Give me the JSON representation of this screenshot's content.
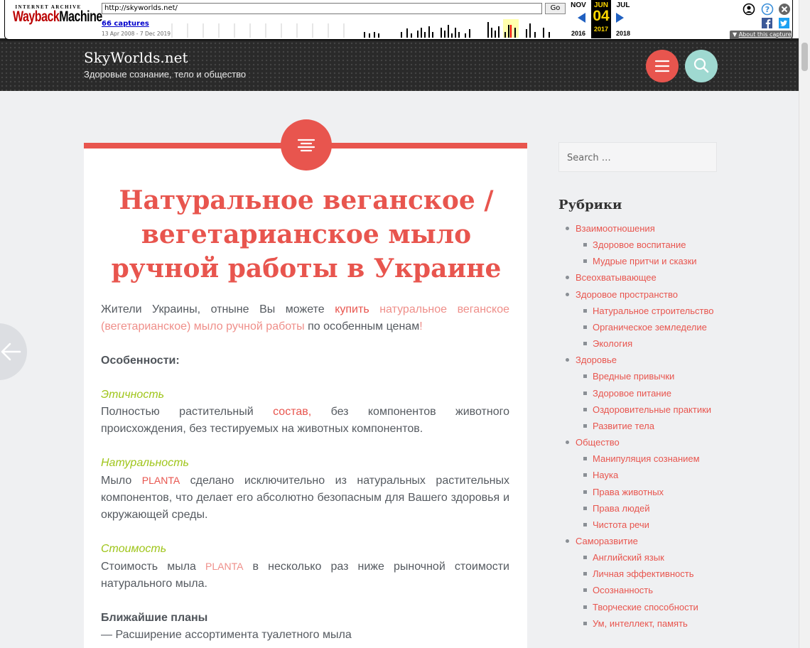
{
  "wayback": {
    "logo_top": "INTERNET ARCHIVE",
    "logo_main_red": "Wayback",
    "logo_main_black": "Machine",
    "url": "http://skyworlds.net/",
    "go_label": "Go",
    "captures": "66 captures",
    "date_range": "13 Apr 2008 - 7 Dec 2019",
    "prev_month": "NOV",
    "cur_month": "JUN",
    "next_month": "JUL",
    "cur_day": "04",
    "prev_year": "2016",
    "cur_year": "2017",
    "next_year": "2018",
    "about": "About this capture",
    "accent": "#ffd700"
  },
  "header": {
    "site_title": "SkyWorlds.net",
    "description": "Здоровые сознание, тело и общество",
    "menu_color": "#e8554e",
    "search_color": "#9fd9d1"
  },
  "article": {
    "title": "Натуральное веганское / вегетарианское мыло ручной работы в Украине",
    "intro_a": "Жители Украины, отныне Вы можете ",
    "intro_buy": "купить",
    "intro_sp": " ",
    "intro_link": "натуральное веганское (вегетарианское) мыло ручной работы",
    "intro_b": " по особенным ценам",
    "intro_excl": "!",
    "features_heading": "Особенности:",
    "ethics_title": "Этичность",
    "ethics_a": "Полностью растительный ",
    "ethics_link": "состав,",
    "ethics_b": " без компонентов животного происхождения, без тестируемых на животных компонентов.",
    "natural_title": "Натуральность",
    "natural_a": "Мыло ",
    "natural_brand": "PLANTA",
    "natural_b": " сделано исключительно из натуральных растительных компонентов, что делает его абсолютно безопасным для Вашего здоровья и окружающей среды.",
    "cost_title": "Стоимость",
    "cost_a": "Стоимость мыла ",
    "cost_brand": "PLANTA",
    "cost_b": " в несколько раз ниже рыночной стоимости натурального мыла.",
    "plans_heading": "Ближайшие планы",
    "plan_1": "— Расширение ассортимента туалетного мыла"
  },
  "sidebar": {
    "search_placeholder": "Search …",
    "categories_title": "Рубрики",
    "categories": [
      {
        "label": "Взаимоотношения",
        "level": 1
      },
      {
        "label": "Здоровое воспитание",
        "level": 2
      },
      {
        "label": "Мудрые притчи и сказки",
        "level": 2
      },
      {
        "label": "Всеохватывающее",
        "level": 1
      },
      {
        "label": "Здоровое пространство",
        "level": 1
      },
      {
        "label": "Натуральное строительство",
        "level": 2
      },
      {
        "label": "Органическое земледелие",
        "level": 2
      },
      {
        "label": "Экология",
        "level": 2
      },
      {
        "label": "Здоровье",
        "level": 1
      },
      {
        "label": "Вредные привычки",
        "level": 2
      },
      {
        "label": "Здоровое питание",
        "level": 2
      },
      {
        "label": "Оздоровительные практики",
        "level": 2
      },
      {
        "label": "Развитие тела",
        "level": 2
      },
      {
        "label": "Общество",
        "level": 1
      },
      {
        "label": "Манипуляция сознанием",
        "level": 2
      },
      {
        "label": "Наука",
        "level": 2
      },
      {
        "label": "Права животных",
        "level": 2
      },
      {
        "label": "Права людей",
        "level": 2
      },
      {
        "label": "Чистота речи",
        "level": 2
      },
      {
        "label": "Саморазвитие",
        "level": 1
      },
      {
        "label": "Английский язык",
        "level": 2
      },
      {
        "label": "Личная эффективность",
        "level": 2
      },
      {
        "label": "Осознанность",
        "level": 2
      },
      {
        "label": "Творческие способности",
        "level": 2
      },
      {
        "label": "Ум, интеллект, память",
        "level": 2
      }
    ]
  },
  "colors": {
    "accent": "#e8554e",
    "accent_light": "#ef8f8a",
    "green": "#9fc51a"
  }
}
